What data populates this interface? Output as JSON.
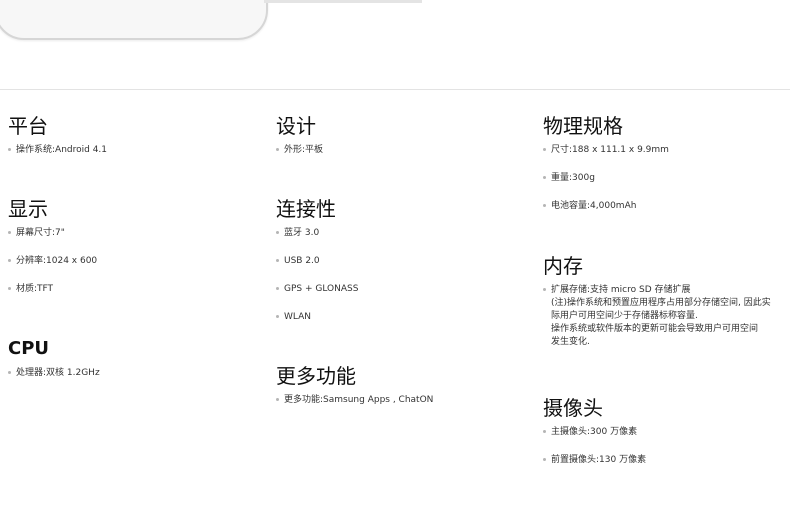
{
  "tablet": {
    "menu_icon": "menu-icon",
    "home_icon": "home-button-icon",
    "back_icon": "back-icon",
    "back_glyph": "⮌"
  },
  "columns": [
    {
      "sections": [
        {
          "title": "平台",
          "items": [
            "操作系统:Android 4.1"
          ]
        },
        {
          "title": "显示",
          "items": [
            "屏幕尺寸:7\"",
            "分辨率:1024 x 600",
            "材质:TFT"
          ]
        },
        {
          "title": "CPU",
          "items": [
            "处理器:双核 1.2GHz"
          ]
        }
      ]
    },
    {
      "sections": [
        {
          "title": "设计",
          "items": [
            "外形:平板"
          ]
        },
        {
          "title": "连接性",
          "items": [
            "蓝牙 3.0",
            "USB 2.0",
            "GPS + GLONASS",
            "WLAN"
          ]
        },
        {
          "title": "更多功能",
          "items": [
            "更多功能:Samsung Apps , ChatON"
          ]
        }
      ]
    },
    {
      "sections": [
        {
          "title": "物理规格",
          "items": [
            "尺寸:188 x 111.1 x 9.9mm",
            "重量:300g",
            "电池容量:4,000mAh"
          ]
        },
        {
          "title": "内存",
          "items": [
            [
              "扩展存储:支持 micro SD 存储扩展",
              "(注)操作系统和预置应用程序占用部分存储空间, 因此实",
              "际用户可用空间少于存储器标称容量.",
              "操作系统或软件版本的更新可能会导致用户可用空间",
              "发生变化."
            ]
          ]
        },
        {
          "title": "摄像头",
          "items": [
            "主摄像头:300 万像素",
            "前置摄像头:130 万像素"
          ]
        }
      ]
    }
  ]
}
